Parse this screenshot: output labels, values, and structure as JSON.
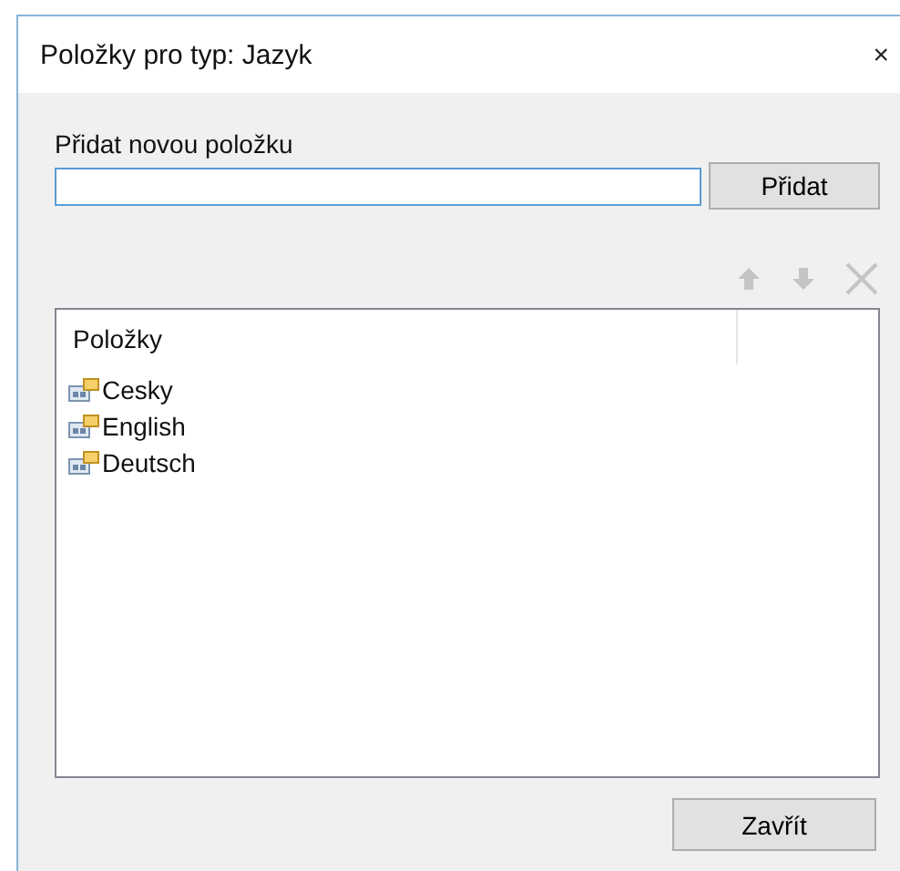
{
  "window": {
    "title": "Položky pro typ: Jazyk",
    "close": "×"
  },
  "new_item": {
    "label": "Přidat novou položku",
    "add_button": "Přidat"
  },
  "toolbar": [
    {
      "kind": "up",
      "disabled": true
    },
    {
      "kind": "down",
      "disabled": true
    },
    {
      "kind": "delete",
      "disabled": true
    }
  ],
  "list": {
    "column": "Položky",
    "items": [
      {
        "label": "Cesky"
      },
      {
        "label": "English"
      },
      {
        "label": "Deutsch"
      }
    ]
  },
  "close_button": "Zavřít"
}
